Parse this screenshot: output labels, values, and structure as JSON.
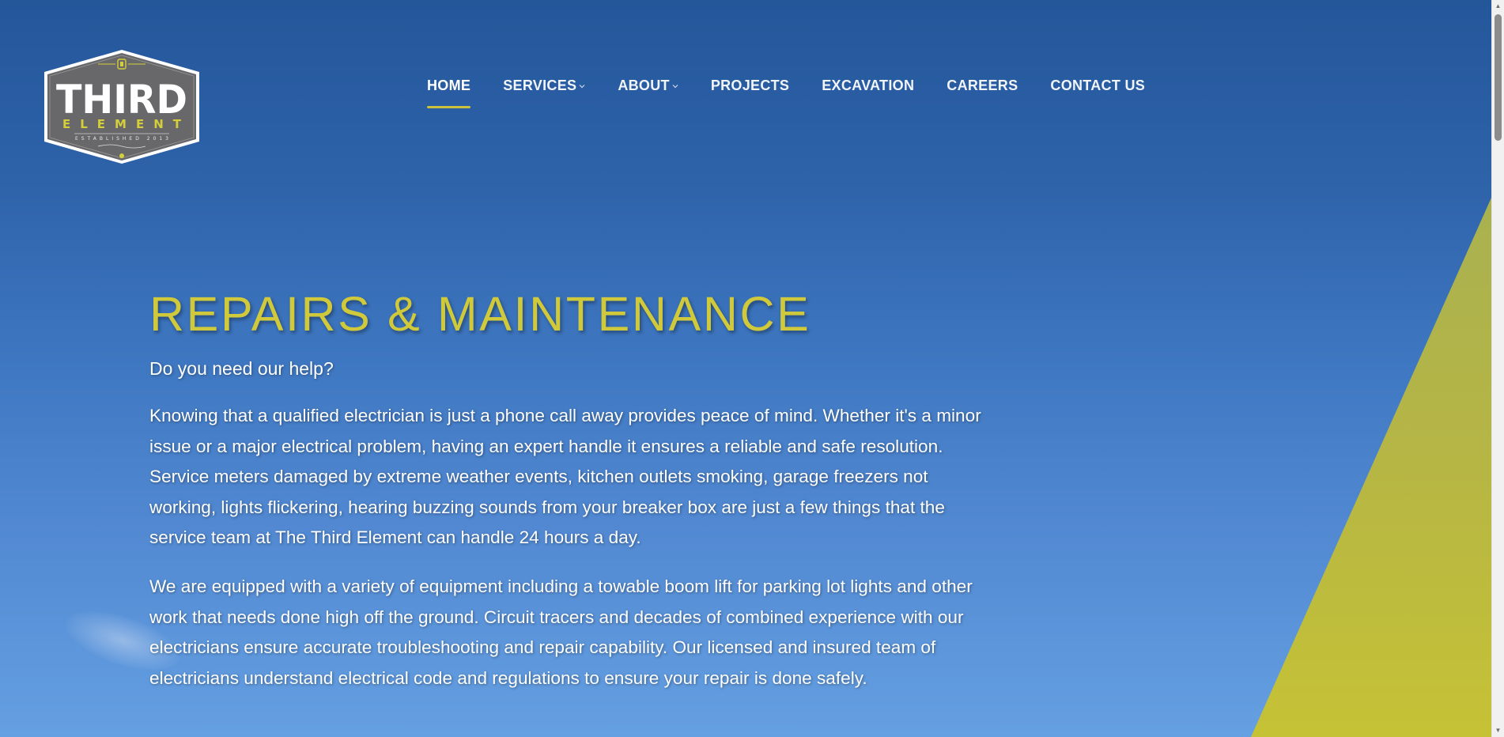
{
  "logo": {
    "line1": "THIRD",
    "line2": "ELEMENT",
    "established": "ESTABLISHED 2013",
    "colors": {
      "badge": "#6a6a6c",
      "border": "#ffffff",
      "accent": "#d4ce3a"
    }
  },
  "nav": {
    "items": [
      {
        "label": "HOME",
        "active": true,
        "dropdown": false
      },
      {
        "label": "SERVICES",
        "active": false,
        "dropdown": true
      },
      {
        "label": "ABOUT",
        "active": false,
        "dropdown": true
      },
      {
        "label": "PROJECTS",
        "active": false,
        "dropdown": false
      },
      {
        "label": "EXCAVATION",
        "active": false,
        "dropdown": false
      },
      {
        "label": "CAREERS",
        "active": false,
        "dropdown": false
      },
      {
        "label": "CONTACT US",
        "active": false,
        "dropdown": false
      }
    ],
    "dropdown_icon": "chevron-down-icon",
    "active_underline_color": "#c9c23a"
  },
  "hero": {
    "title": "REPAIRS & MAINTENANCE",
    "subtitle": "Do you need our help?",
    "paragraphs": [
      "Knowing that a qualified electrician is just a phone call away provides peace of mind. Whether it's a minor issue or a major electrical problem, having an expert handle it ensures a reliable and safe resolution. Service meters damaged by extreme weather events, kitchen outlets smoking, garage freezers not working, lights flickering, hearing buzzing sounds from your breaker box are just a few things that the service team at The Third Element can handle 24 hours a day.",
      "We are equipped with a variety of equipment including a towable boom lift for parking lot lights and other work that needs done high off the ground. Circuit tracers and decades of combined experience with our electricians ensure accurate troubleshooting and repair capability. Our licensed and insured team of electricians understand electrical code and regulations to ensure your repair is done safely."
    ]
  },
  "colors": {
    "title": "#cfc93b",
    "text": "#ffffff",
    "sky_top": "#24569a",
    "sky_bottom": "#65a0e2",
    "wedge": "#c3c03a"
  }
}
